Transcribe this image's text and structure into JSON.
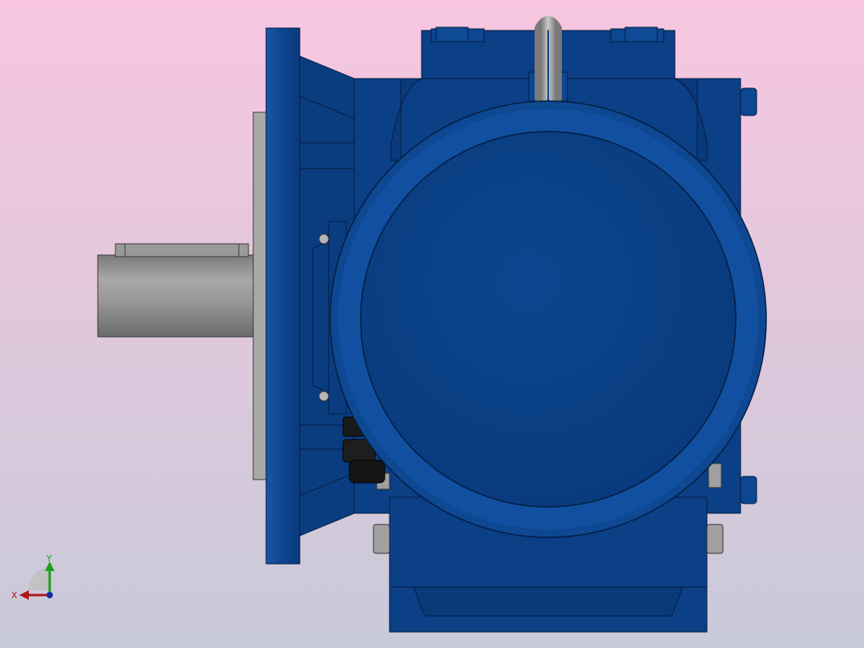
{
  "viewport": {
    "background_top": "#f8c6e0",
    "background_bottom": "#c8cad9"
  },
  "model": {
    "body_color": "#0a3f86",
    "body_light": "#1a56a6",
    "body_dark": "#062b5e",
    "shaft_color": "#8f8f8f",
    "shaft_light": "#b8b8b8",
    "shaft_dark": "#5f5f5f",
    "ring_color": "#b0b0b0",
    "gland_color": "#1a1a1a"
  },
  "triad": {
    "x_label": "X",
    "y_label": "Y",
    "x_color": "#b01818",
    "y_color": "#1aa01a",
    "z_color": "#1a2aa0"
  }
}
